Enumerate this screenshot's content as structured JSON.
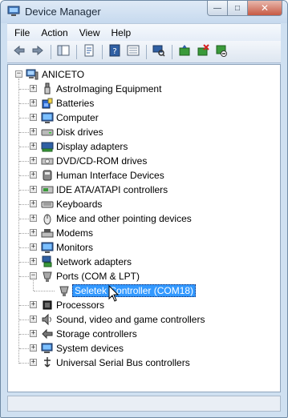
{
  "window": {
    "title": "Device Manager",
    "caption_buttons": {
      "minimize": "—",
      "maximize": "□",
      "close": "✕"
    }
  },
  "menu": [
    "File",
    "Action",
    "View",
    "Help"
  ],
  "toolbar": [
    {
      "name": "back-icon"
    },
    {
      "name": "forward-icon"
    },
    {
      "name": "sep"
    },
    {
      "name": "show-hide-console-tree-icon"
    },
    {
      "name": "sep"
    },
    {
      "name": "properties-icon"
    },
    {
      "name": "sep"
    },
    {
      "name": "help-icon"
    },
    {
      "name": "view-icon"
    },
    {
      "name": "sep"
    },
    {
      "name": "scan-hardware-icon"
    },
    {
      "name": "sep"
    },
    {
      "name": "update-driver-icon"
    },
    {
      "name": "uninstall-icon"
    },
    {
      "name": "disable-icon"
    }
  ],
  "tree": {
    "root": {
      "label": "ANICETO",
      "icon": "computer-icon",
      "expanded": true
    },
    "categories": [
      {
        "label": "AstroImaging Equipment",
        "icon": "usb-plug-icon",
        "expanded": false
      },
      {
        "label": "Batteries",
        "icon": "battery-icon",
        "expanded": false
      },
      {
        "label": "Computer",
        "icon": "monitor-icon",
        "expanded": false
      },
      {
        "label": "Disk drives",
        "icon": "disk-drive-icon",
        "expanded": false
      },
      {
        "label": "Display adapters",
        "icon": "display-adapter-icon",
        "expanded": false
      },
      {
        "label": "DVD/CD-ROM drives",
        "icon": "dvd-drive-icon",
        "expanded": false
      },
      {
        "label": "Human Interface Devices",
        "icon": "hid-icon",
        "expanded": false
      },
      {
        "label": "IDE ATA/ATAPI controllers",
        "icon": "ide-controller-icon",
        "expanded": false
      },
      {
        "label": "Keyboards",
        "icon": "keyboard-icon",
        "expanded": false
      },
      {
        "label": "Mice and other pointing devices",
        "icon": "mouse-icon",
        "expanded": false
      },
      {
        "label": "Modems",
        "icon": "modem-icon",
        "expanded": false
      },
      {
        "label": "Monitors",
        "icon": "monitor-icon",
        "expanded": false
      },
      {
        "label": "Network adapters",
        "icon": "network-adapter-icon",
        "expanded": false
      },
      {
        "label": "Ports (COM & LPT)",
        "icon": "port-icon",
        "expanded": true,
        "children": [
          {
            "label": "Seletek Controller (COM18)",
            "icon": "port-icon",
            "selected": true
          }
        ]
      },
      {
        "label": "Processors",
        "icon": "processor-icon",
        "expanded": false
      },
      {
        "label": "Sound, video and game controllers",
        "icon": "speaker-icon",
        "expanded": false
      },
      {
        "label": "Storage controllers",
        "icon": "storage-controller-icon",
        "expanded": false
      },
      {
        "label": "System devices",
        "icon": "system-device-icon",
        "expanded": false
      },
      {
        "label": "Universal Serial Bus controllers",
        "icon": "usb-controller-icon",
        "expanded": false
      }
    ]
  },
  "colors": {
    "selection": "#3399ff",
    "frame": "#cfe0f1"
  }
}
